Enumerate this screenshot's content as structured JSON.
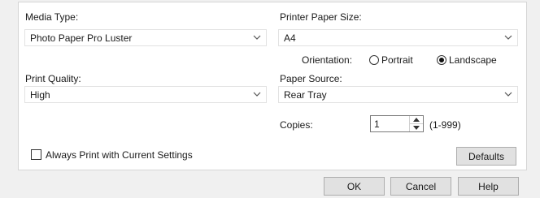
{
  "media_type": {
    "label": "Media Type:",
    "value": "Photo Paper Pro Luster"
  },
  "print_quality": {
    "label": "Print Quality:",
    "value": "High"
  },
  "paper_size": {
    "label": "Printer Paper Size:",
    "value": "A4"
  },
  "orientation": {
    "label": "Orientation:",
    "options": [
      "Portrait",
      "Landscape"
    ],
    "selected": "Landscape"
  },
  "paper_source": {
    "label": "Paper Source:",
    "value": "Rear Tray"
  },
  "copies": {
    "label": "Copies:",
    "value": "1",
    "range": "(1-999)"
  },
  "always_print": {
    "label": "Always Print with Current Settings",
    "checked": false
  },
  "buttons": {
    "defaults": "Defaults",
    "ok": "OK",
    "cancel": "Cancel",
    "help": "Help"
  }
}
